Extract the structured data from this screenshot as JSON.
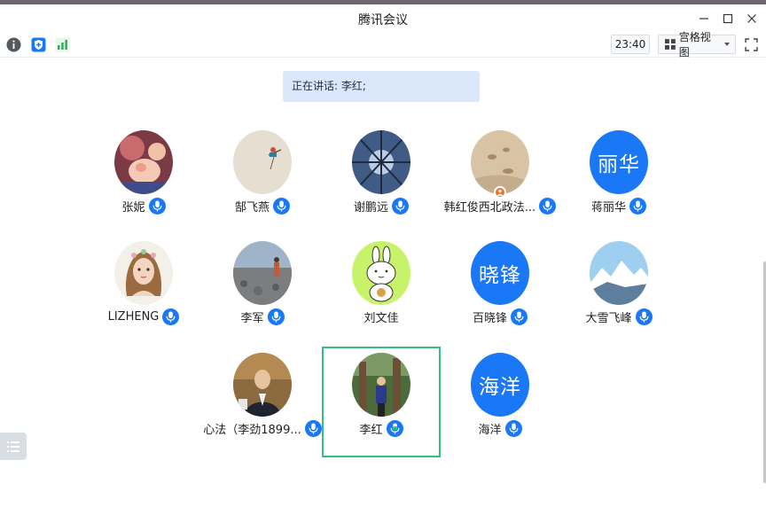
{
  "window": {
    "title": "腾讯会议"
  },
  "toolbar": {
    "timer": "23:40",
    "view_label": "宫格视图"
  },
  "speaking": {
    "text": "正在讲话: 李红;"
  },
  "participants": [
    {
      "name": "张妮",
      "mic": "on"
    },
    {
      "name": "郜飞燕",
      "mic": "on"
    },
    {
      "name": "谢鹏远",
      "mic": "on"
    },
    {
      "name": "韩红俊西北政法...",
      "mic": "on",
      "host": true
    },
    {
      "name": "蒋丽华",
      "mic": "on",
      "avatar_text": "丽华"
    },
    {
      "name": "LIZHENG",
      "mic": "on"
    },
    {
      "name": "李军",
      "mic": "on"
    },
    {
      "name": "刘文佳",
      "mic": "none"
    },
    {
      "name": "百晓锋",
      "mic": "on",
      "avatar_text": "晓锋"
    },
    {
      "name": "大雪飞峰",
      "mic": "on"
    },
    {
      "name": "心法（李劲1899...",
      "mic": "on"
    },
    {
      "name": "李红",
      "mic": "speaking",
      "active_speaker": true
    },
    {
      "name": "海洋",
      "mic": "on",
      "avatar_text": "海洋"
    }
  ],
  "colors": {
    "accent": "#1a77f5",
    "active_frame": "#2ec27e",
    "speaking_bg": "#dbe7fb",
    "host_badge": "#f26f28"
  }
}
